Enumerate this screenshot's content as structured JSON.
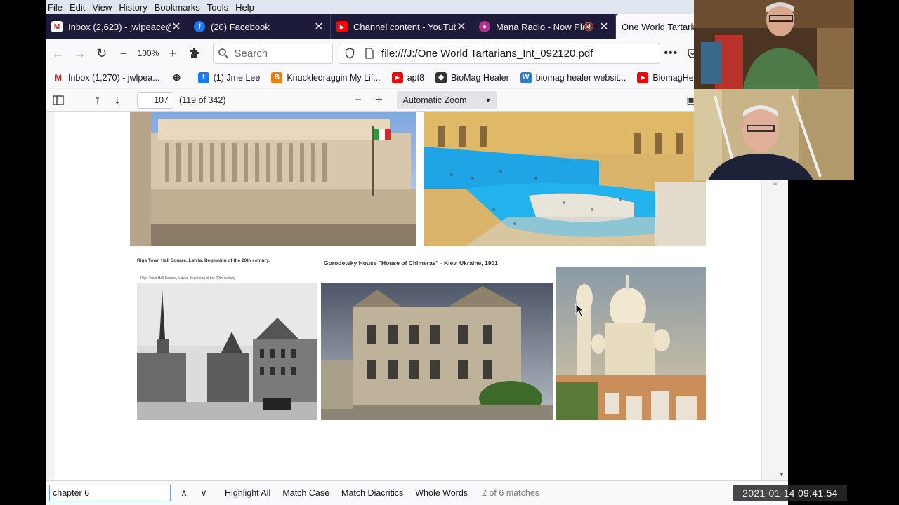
{
  "menubar": {
    "items": [
      {
        "label": "File",
        "ul": "F"
      },
      {
        "label": "Edit",
        "ul": "E"
      },
      {
        "label": "View",
        "ul": "V"
      },
      {
        "label": "History",
        "ul": "S"
      },
      {
        "label": "Bookmarks",
        "ul": "B"
      },
      {
        "label": "Tools",
        "ul": "T"
      },
      {
        "label": "Help",
        "ul": "H"
      }
    ]
  },
  "tabs": [
    {
      "title": "Inbox (2,623) - jwlpeace@",
      "icon": "gmail-icon",
      "color": "#c5221f",
      "active": false
    },
    {
      "title": "(20) Facebook",
      "icon": "facebook-icon",
      "color": "#1877f2",
      "active": false
    },
    {
      "title": "Channel content - YouTub",
      "icon": "youtube-icon",
      "color": "#ff0000",
      "active": false
    },
    {
      "title": "Mana Radio - Now Pla",
      "icon": "mana-radio-icon",
      "color": "#b0308a",
      "active": false
    },
    {
      "title": "One World Tartarians",
      "icon": "pdf-icon",
      "color": "#666",
      "active": true
    }
  ],
  "nav": {
    "zoom": "100%",
    "search_placeholder": "Search",
    "url": "file:///J:/One World Tartarians_Int_092120.pdf"
  },
  "bookmarks": [
    {
      "label": "Inbox (1,270) - jwlpea...",
      "icon": "gmail-icon",
      "color": "#c5221f"
    },
    {
      "label": "",
      "icon": "globe-icon",
      "color": "#444"
    },
    {
      "label": "(1) Jme Lee",
      "icon": "facebook-icon",
      "color": "#1877f2"
    },
    {
      "label": "Knuckledraggin My Lif...",
      "icon": "blogger-icon",
      "color": "#f57d00"
    },
    {
      "label": "apt8",
      "icon": "youtube-icon",
      "color": "#ff0000"
    },
    {
      "label": "BioMag Healer",
      "icon": "cube-icon",
      "color": "#333"
    },
    {
      "label": "biomag healer websit...",
      "icon": "word-icon",
      "color": "#2b7cd3"
    },
    {
      "label": "BiomagHealer -",
      "icon": "youtube-icon",
      "color": "#ff0000"
    }
  ],
  "pdf": {
    "page_number": "107",
    "page_count": "(119 of 342)",
    "zoom_mode": "Automatic Zoom"
  },
  "document": {
    "caption_riga": "Riga Town Hall Square, Latvia. Beginning of the 20th century.",
    "caption_riga_small": "Riga Town Hall Square, Latvia. Beginning of the 20th century.",
    "caption_gorodetsky": "Gorodetsky House \"House of Chimeras\" - Kiev, Ukraine, 1901"
  },
  "findbar": {
    "query": "chapter 6",
    "highlight_all": "Highlight All",
    "match_case": "Match Case",
    "match_diacritics": "Match Diacritics",
    "whole_words": "Whole Words",
    "match_count": "2 of 6 matches"
  },
  "overlay": {
    "timestamp": "2021-01-14  09:41:54"
  },
  "colors": {
    "tab_bar": "#1c1b3a",
    "find_focus": "#6aa2e8"
  }
}
